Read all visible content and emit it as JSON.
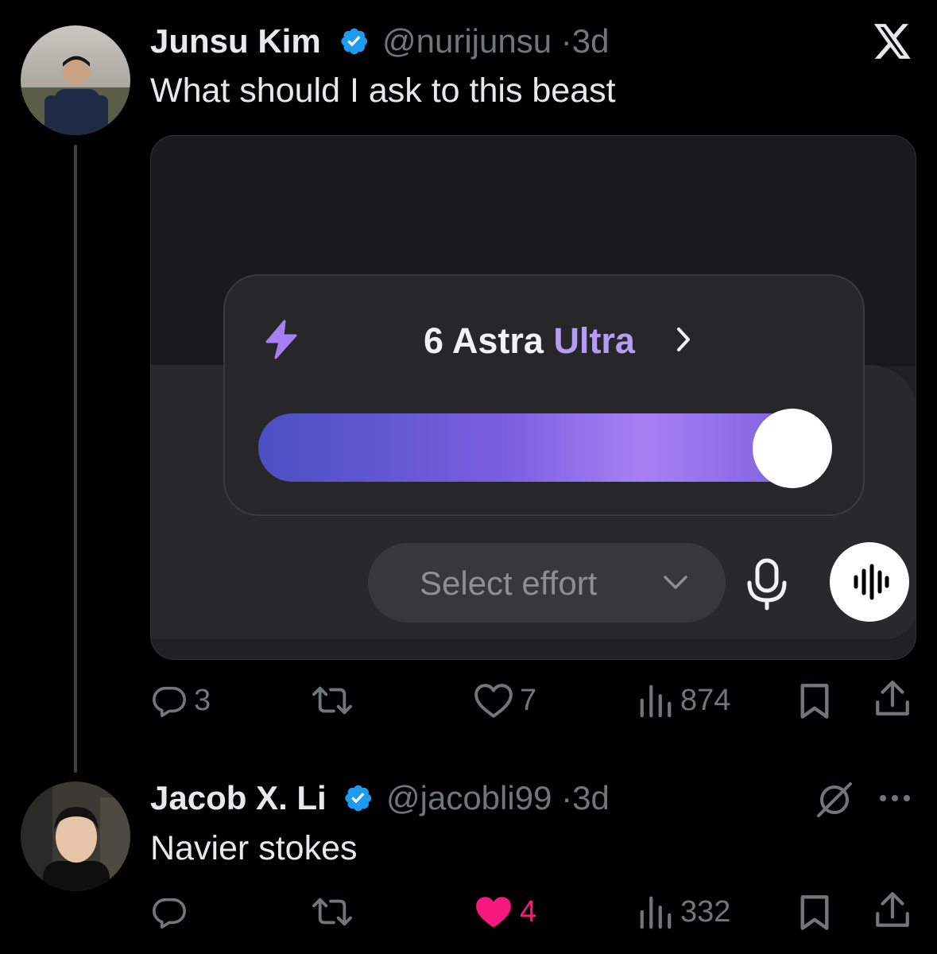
{
  "post": {
    "author_name": "Junsu Kim",
    "handle": "@nurijunsu",
    "separator": "·",
    "time": "3d",
    "text": "What should I ask to this beast",
    "actions": {
      "replies": "3",
      "reposts": "",
      "likes": "7",
      "views": "874"
    }
  },
  "media": {
    "model_number": "6 Astra",
    "model_tier": "Ultra",
    "chevron": "›",
    "slider_level": 1.0,
    "effort_label": "Select effort",
    "accent_color": "#b69cf7"
  },
  "reply": {
    "author_name": "Jacob X. Li",
    "handle": "@jacobli99",
    "separator": "·",
    "time": "3d",
    "text": "Navier stokes",
    "actions": {
      "replies": "",
      "reposts": "",
      "likes": "4",
      "views": "332"
    }
  },
  "icons": {
    "brand": "x-logo-icon",
    "verified": "verified-badge-icon",
    "reply": "reply-icon",
    "repost": "repost-icon",
    "like": "heart-icon",
    "views": "views-icon",
    "bookmark": "bookmark-icon",
    "share": "share-icon",
    "grok": "grok-icon",
    "more": "more-icon"
  },
  "colors": {
    "background": "#000000",
    "verified": "#1d9bf0",
    "like_active": "#f91880",
    "muted": "#71767b"
  }
}
